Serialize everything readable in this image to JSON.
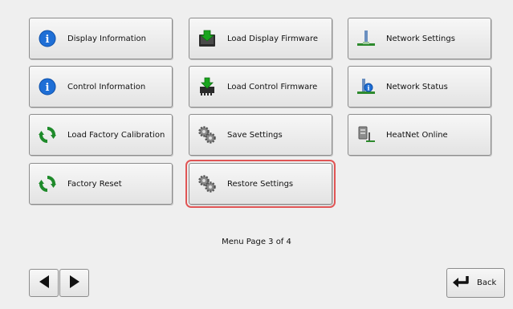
{
  "buttons": {
    "display_information": "Display Information",
    "control_information": "Control Information",
    "load_factory_calibration": "Load Factory Calibration",
    "factory_reset": "Factory Reset",
    "load_display_firmware": "Load Display Firmware",
    "load_control_firmware": "Load Control Firmware",
    "save_settings": "Save Settings",
    "restore_settings": "Restore Settings",
    "network_settings": "Network Settings",
    "network_status": "Network Status",
    "heatnet_online": "HeatNet Online"
  },
  "footer": {
    "page_indicator": "Menu Page 3 of 4",
    "back_label": "Back"
  },
  "icons": {
    "info": "info-icon",
    "refresh": "refresh-icon",
    "download": "download-icon",
    "gears": "gears-icon",
    "network": "network-icon",
    "heatnet": "heatnet-icon",
    "prev": "left-arrow-icon",
    "next": "right-arrow-icon",
    "back": "back-arrow-icon"
  },
  "colors": {
    "highlight": "#e05555",
    "info_blue": "#1f6fd6",
    "refresh_green": "#1e8a2a",
    "download_green": "#19a51d"
  },
  "highlighted_button": "Restore Settings"
}
